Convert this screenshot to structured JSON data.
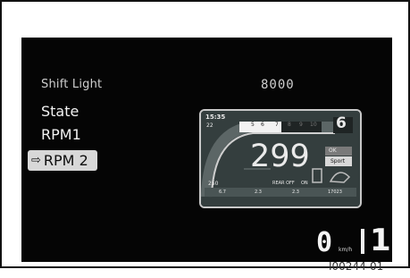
{
  "menu": {
    "title": "Shift Light",
    "items": [
      {
        "label": "State"
      },
      {
        "label": "RPM1"
      },
      {
        "label": "RPM 2",
        "selected_arrow": "⇨"
      }
    ]
  },
  "setting_value": "8000",
  "preview": {
    "time": "15:35",
    "temp": "22",
    "rpm_scale": [
      "5",
      "6",
      "7",
      "8",
      "9",
      "10"
    ],
    "gear": "6",
    "speed": "299",
    "low_value": "250",
    "status_ok": "OK",
    "mode": "Sport",
    "bottom_row": [
      "6.7",
      "2.3",
      "2.3",
      "17023"
    ],
    "bottom_labels": [
      "REAR OFF",
      "ON"
    ]
  },
  "status_bar": {
    "speed": "0",
    "speed_unit": "km/h",
    "gear": "1"
  },
  "figure_id": "I00244-01",
  "colors": {
    "screen_bg": "#050505",
    "selected_bg": "#d8d8d8",
    "preview_bg": "#2f3838"
  }
}
